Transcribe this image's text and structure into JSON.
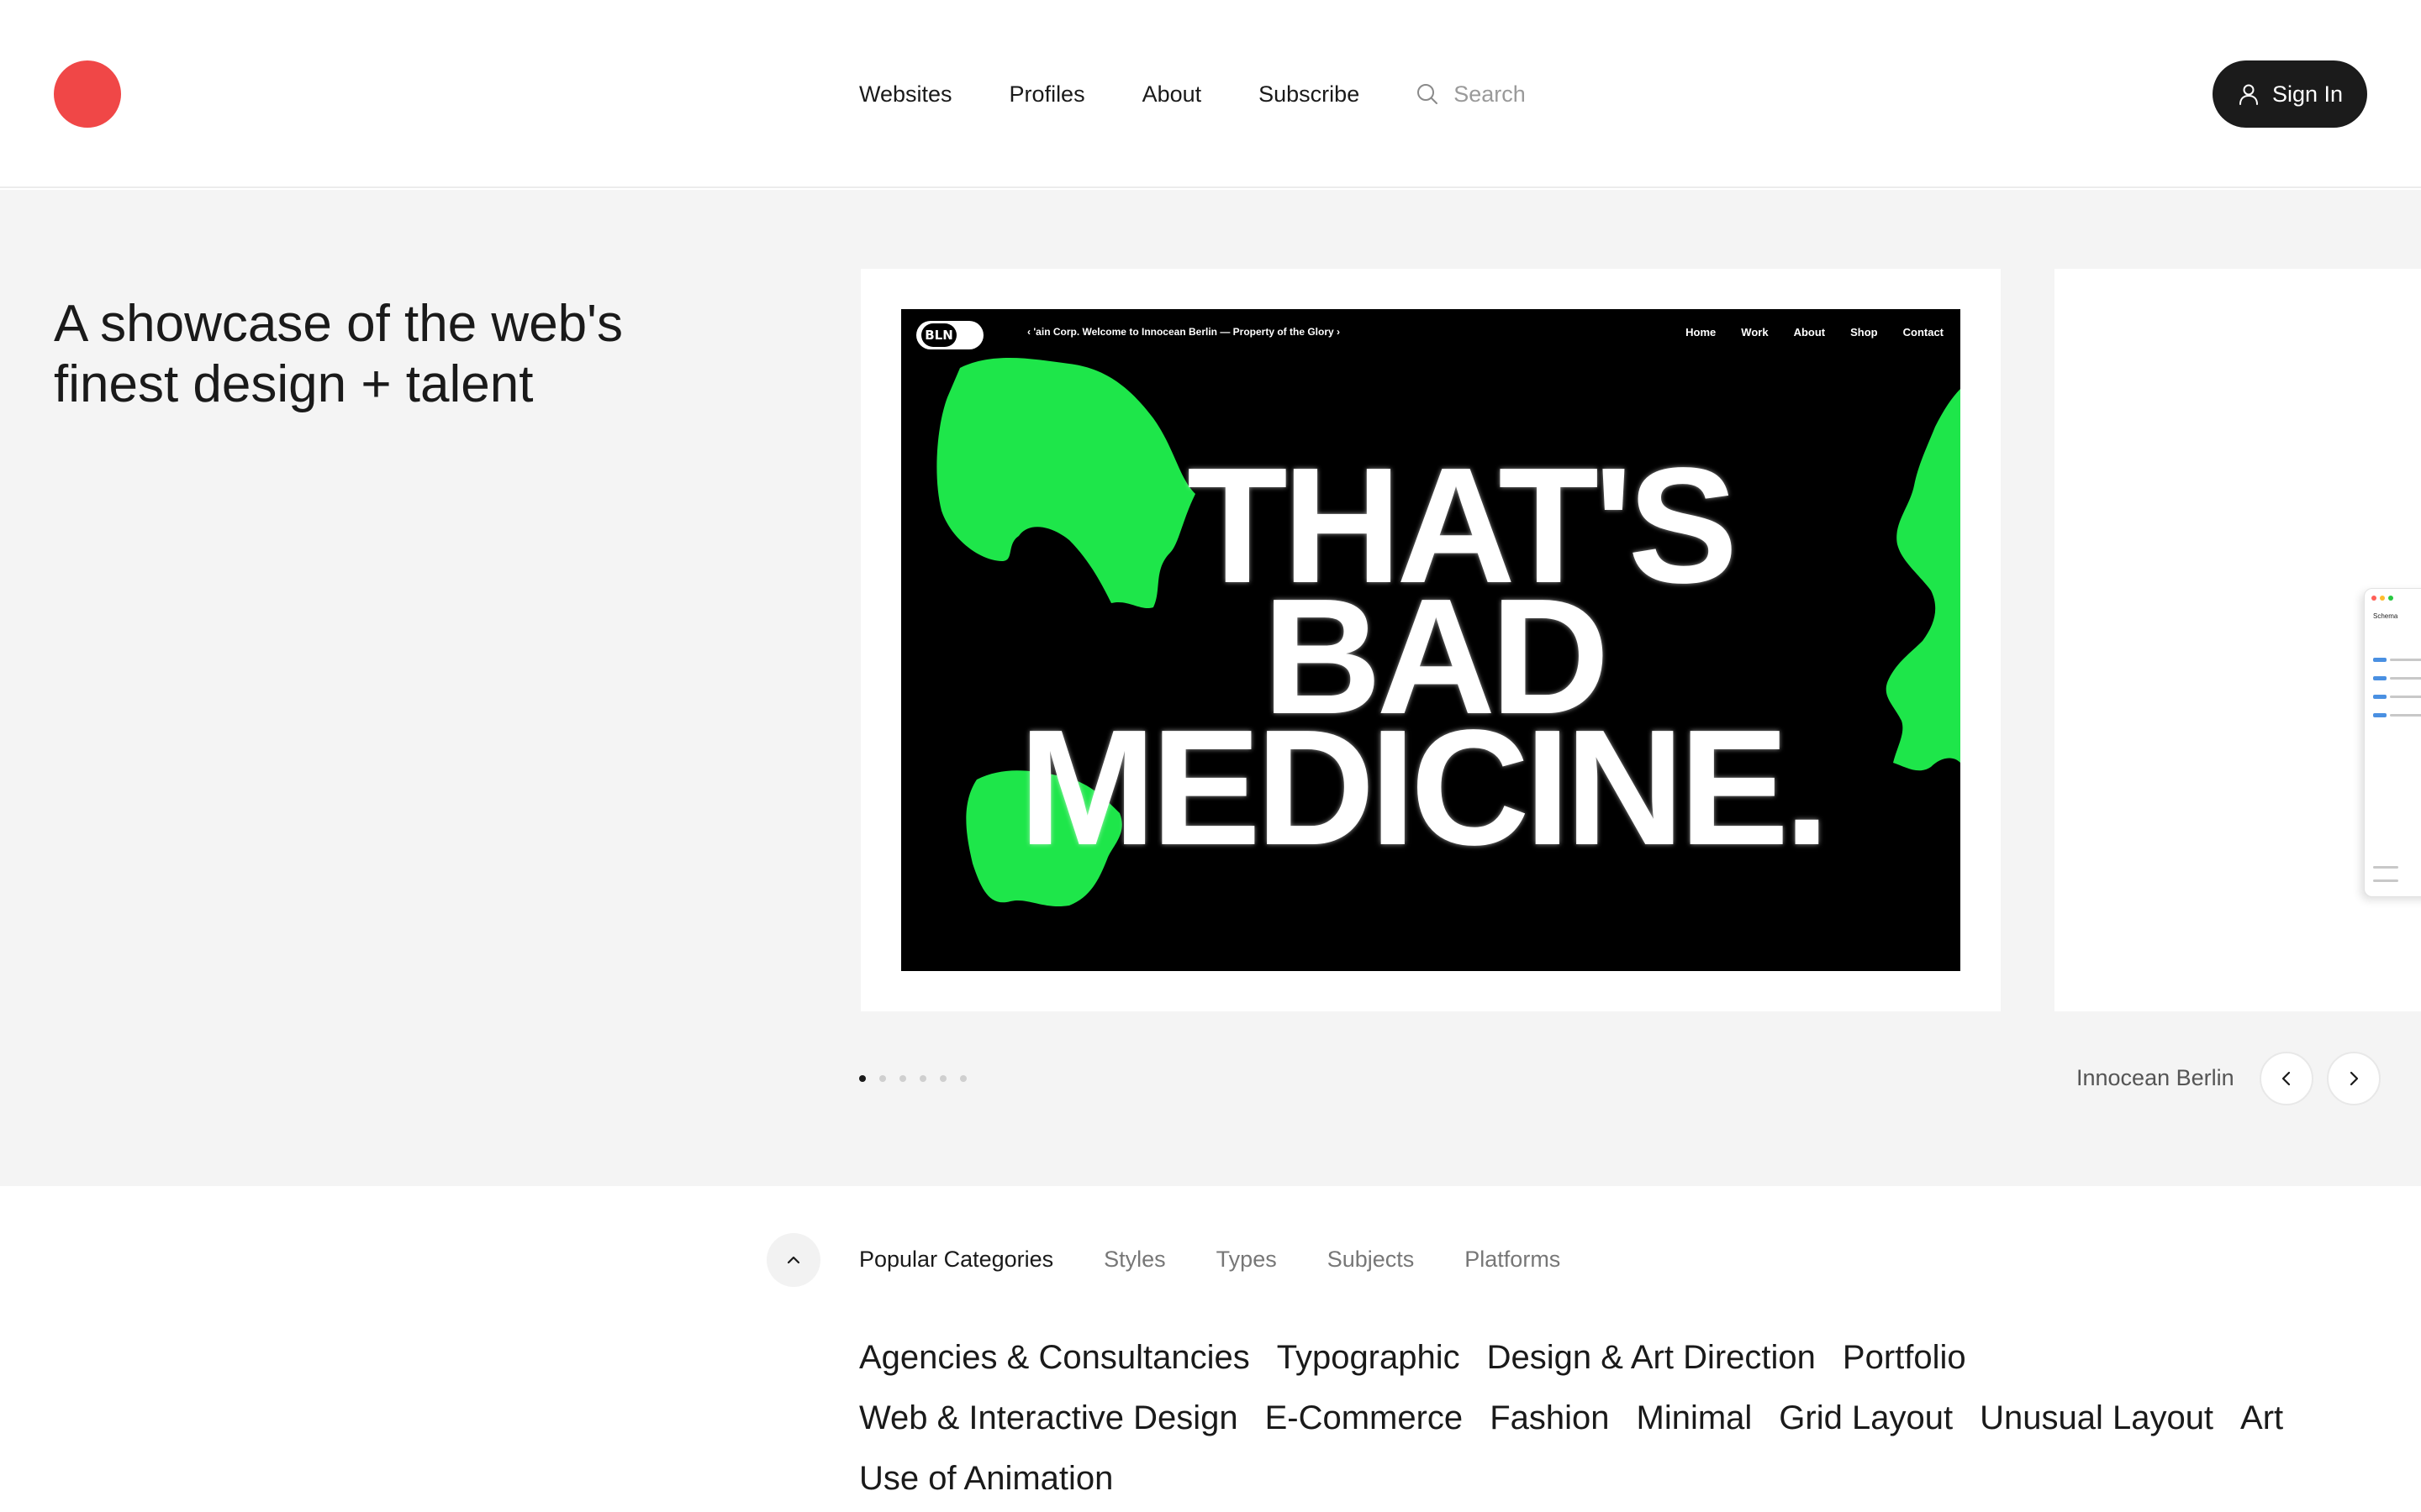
{
  "header": {
    "nav": [
      "Websites",
      "Profiles",
      "About",
      "Subscribe"
    ],
    "search_placeholder": "Search",
    "signin_label": "Sign In"
  },
  "hero": {
    "tagline": "A showcase of the web's finest design + talent",
    "featured": {
      "site_name": "Innocean Berlin",
      "screenshot": {
        "badge": "BLN",
        "ticker": "‹  'ain Corp. Welcome to Innocean Berlin — Property of the Glory  ›",
        "nav": [
          "Home",
          "Work",
          "About",
          "Shop",
          "Contact"
        ],
        "headline": [
          "THAT'S",
          "BAD",
          "MEDICINE."
        ],
        "accent_color": "#1ee64a"
      }
    },
    "peek": {
      "title": "Schema"
    },
    "carousel": {
      "total_slides": 6,
      "active_index": 0
    }
  },
  "categories": {
    "tabs": [
      "Popular Categories",
      "Styles",
      "Types",
      "Subjects",
      "Platforms"
    ],
    "active_tab": 0,
    "links": [
      "Agencies & Consultancies",
      "Typographic",
      "Design & Art Direction",
      "Portfolio",
      "Web & Interactive Design",
      "E-Commerce",
      "Fashion",
      "Minimal",
      "Grid Layout",
      "Unusual Layout",
      "Art",
      "Use of Animation"
    ]
  },
  "colors": {
    "brand": "#f04747",
    "button_dark": "#1b1b1b",
    "hero_bg": "#f4f4f4"
  },
  "icons": {
    "logo": "red-circle-logo",
    "search": "search-icon",
    "user": "user-icon",
    "prev": "chevron-left-icon",
    "next": "chevron-right-icon",
    "collapse": "chevron-up-icon"
  }
}
